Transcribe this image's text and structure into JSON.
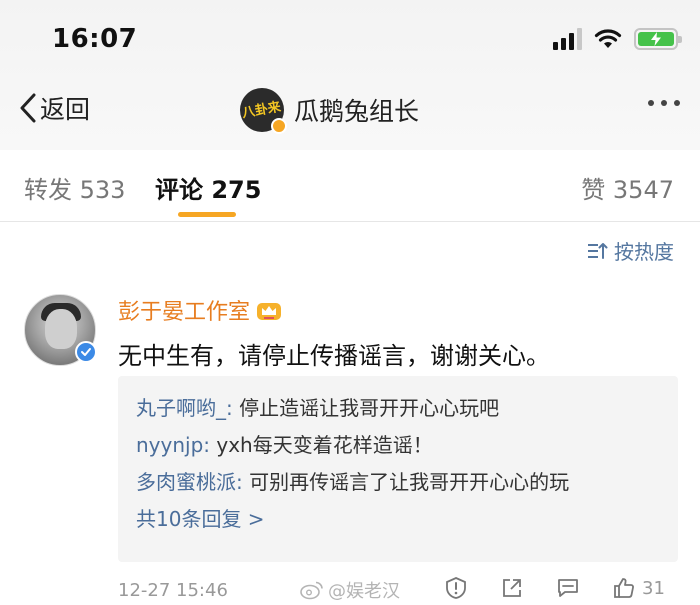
{
  "status_bar": {
    "time": "16:07",
    "battery_level": 1.0,
    "signal_bars": 3
  },
  "nav": {
    "back_label": "返回",
    "avatar_text": "八卦来",
    "title": "瓜鹅兔组长"
  },
  "tabs": [
    {
      "label": "转发 533",
      "active": false
    },
    {
      "label": "评论 275",
      "active": true
    },
    {
      "label": "赞 3547",
      "active": false
    }
  ],
  "sort": {
    "label": "按热度"
  },
  "comment": {
    "author": "彭于晏工作室",
    "text": "无中生有，请停止传播谣言，谢谢关心。",
    "replies": [
      {
        "user": "丸子啊哟_:",
        "text": " 停止造谣让我哥开开心心玩吧"
      },
      {
        "user": "nyynjp:",
        "text": " yxh每天变着花样造谣！"
      },
      {
        "user": "多肉蜜桃派:",
        "text": " 可别再传谣言了让我哥开开心心的玩"
      }
    ],
    "more_replies": "共10条回复 >",
    "time": "12-27 15:46",
    "like_count": "31"
  },
  "watermark": {
    "text": "@娱老汉"
  },
  "colors": {
    "accent": "#f6a623",
    "author": "#e77d20",
    "link": "#4a6d9a",
    "battery": "#45c24a",
    "verified_blue": "#3c8ae6"
  }
}
